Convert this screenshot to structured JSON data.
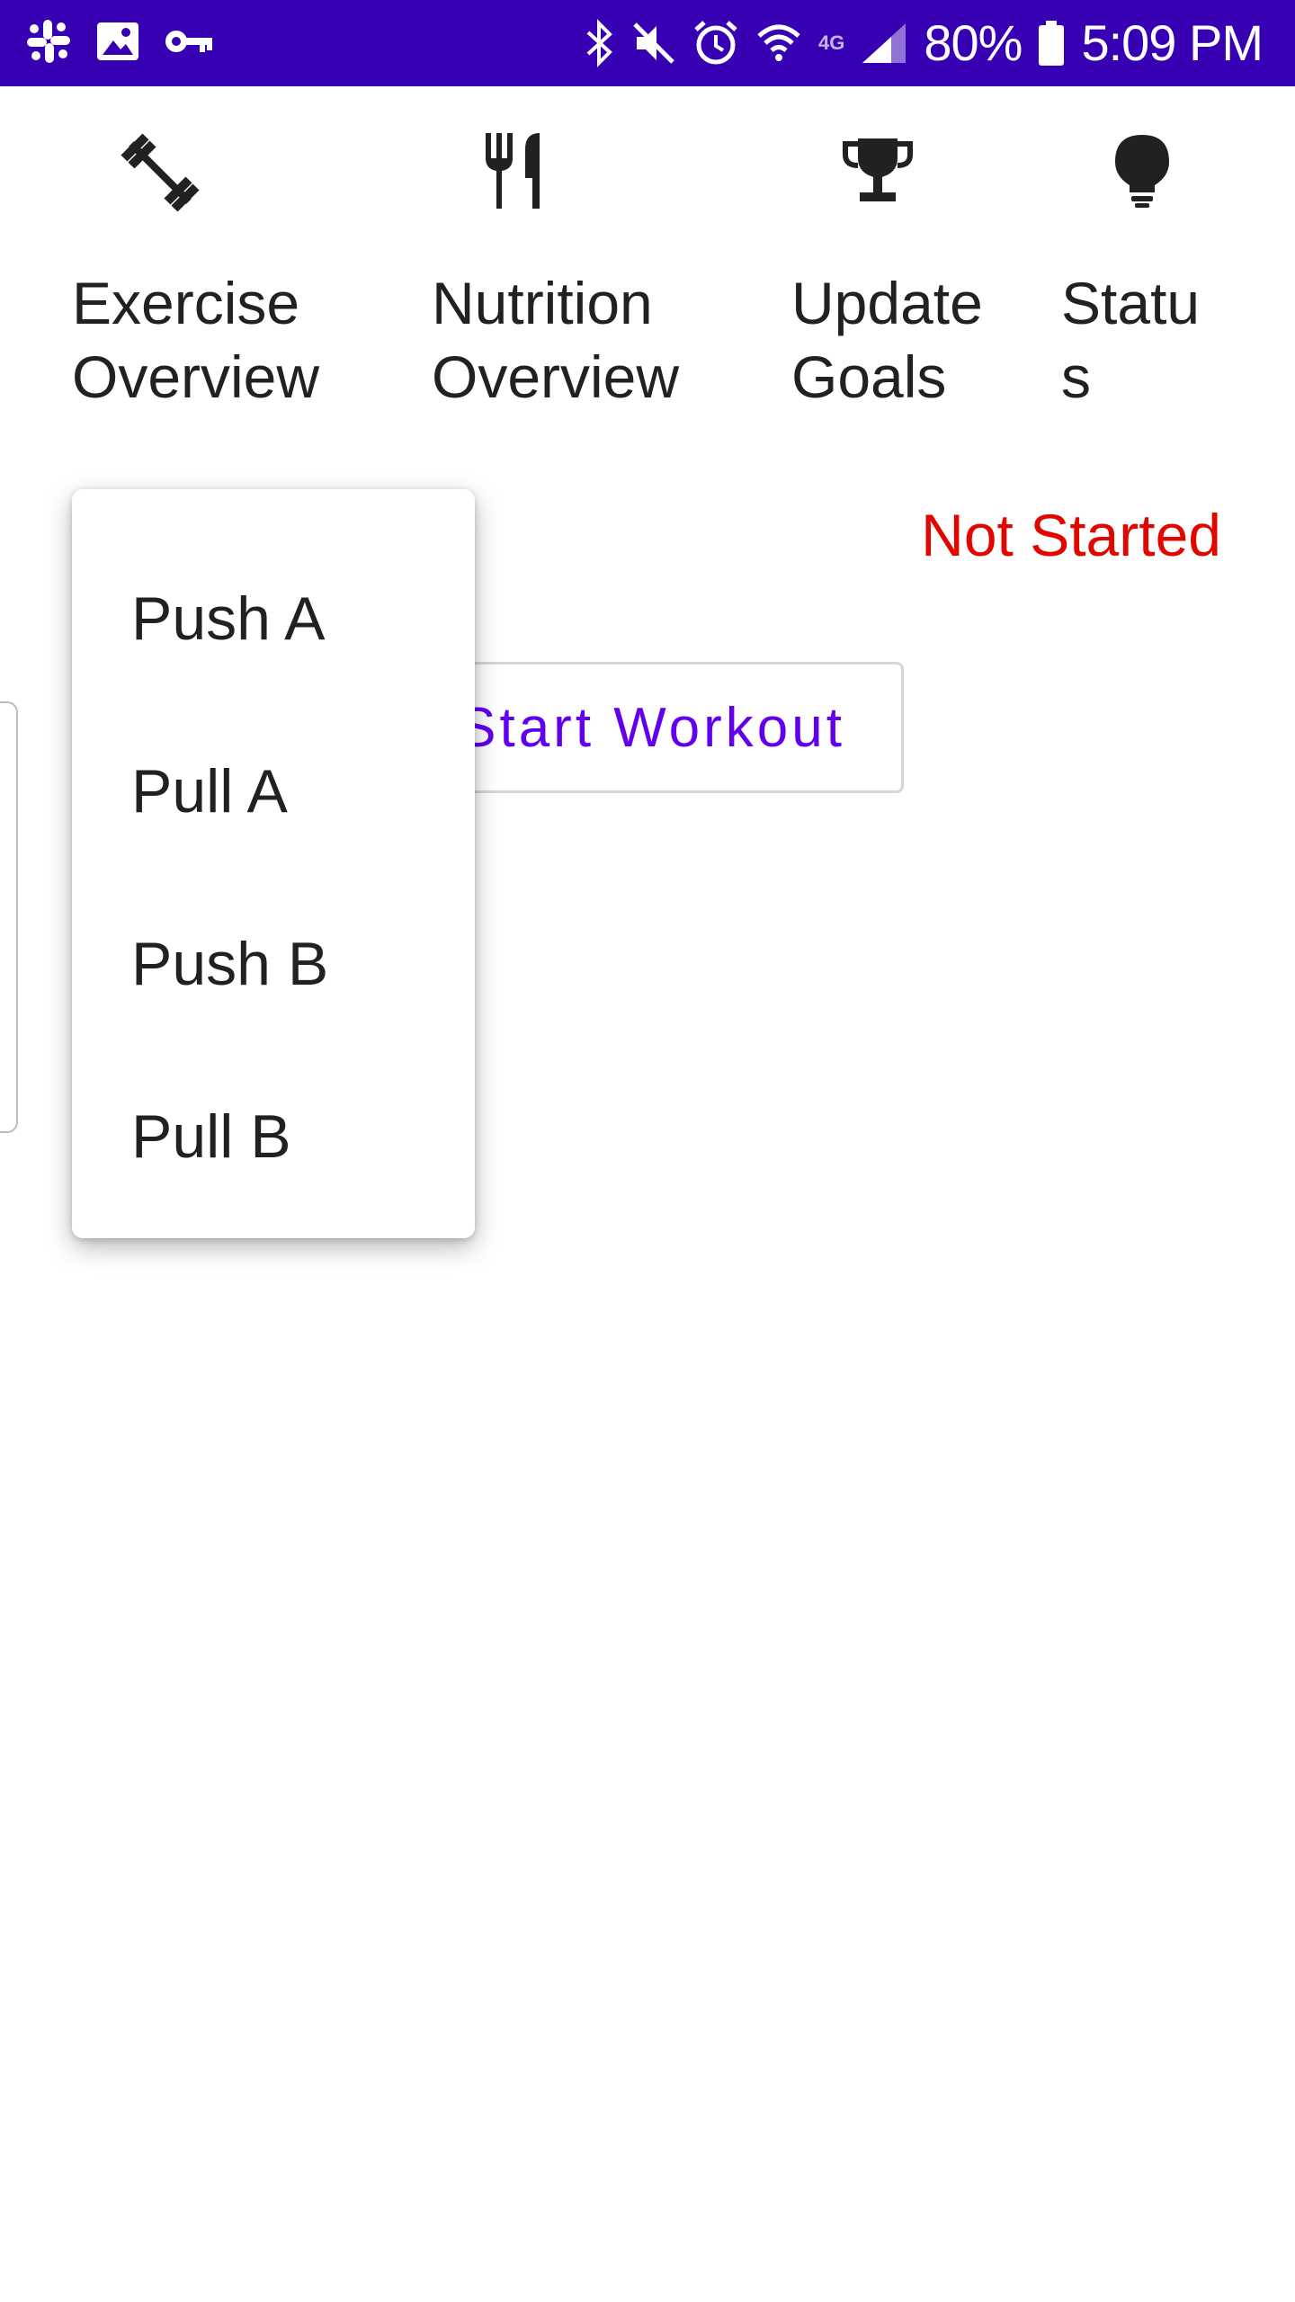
{
  "status_bar": {
    "battery_percent": "80%",
    "time": "5:09 PM",
    "network_label": "4G",
    "left_icons": [
      "slack-icon",
      "image-icon",
      "key-icon"
    ],
    "right_icons": [
      "bluetooth-icon",
      "mute-icon",
      "alarm-icon",
      "wifi-icon",
      "signal-icon",
      "battery-icon"
    ],
    "background_color": "#3700b3"
  },
  "nav": {
    "items": [
      {
        "icon": "dumbbell-icon",
        "label": "Exercise\nOverview"
      },
      {
        "icon": "fork-knife-icon",
        "label": "Nutrition\nOverview"
      },
      {
        "icon": "trophy-icon",
        "label": "Update\nGoals"
      },
      {
        "icon": "lightbulb-icon",
        "label": "Statu\ns"
      }
    ]
  },
  "main": {
    "label_partial": ":",
    "status_value": "Not Started",
    "status_color": "#e10600",
    "start_button_label": "Start Workout",
    "accent_color": "#6200ee"
  },
  "dropdown": {
    "options": [
      "Push A",
      "Pull A",
      "Push B",
      "Pull B"
    ]
  }
}
